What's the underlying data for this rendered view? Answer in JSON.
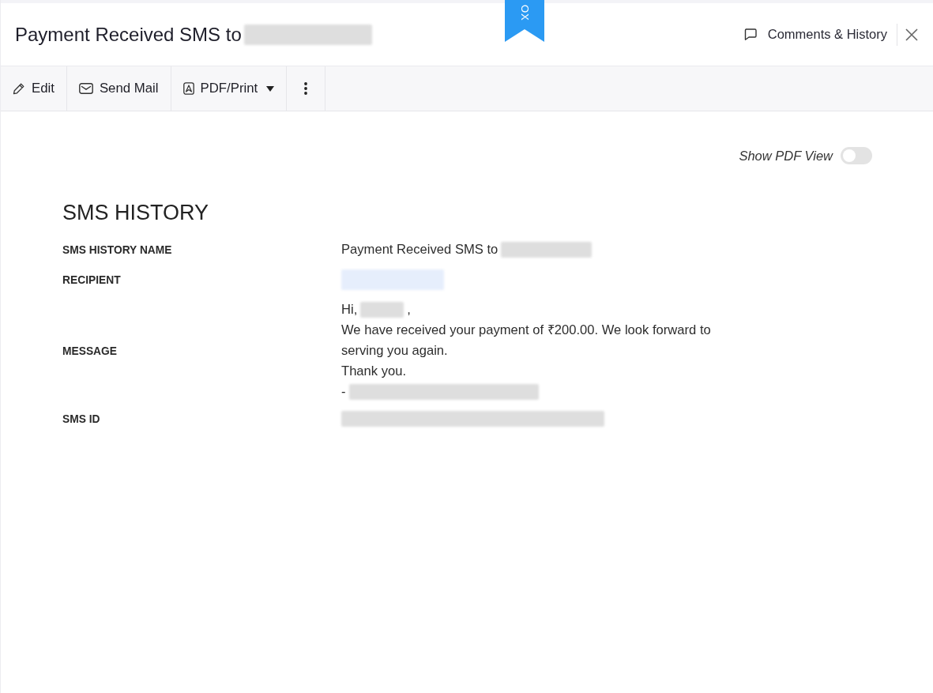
{
  "header": {
    "title": "Payment Received SMS to",
    "title_redacted": true,
    "ribbon": "OX",
    "comments_link": "Comments & History"
  },
  "toolbar": [
    {
      "kind": "edit",
      "label": "Edit"
    },
    {
      "kind": "mail",
      "label": "Send Mail"
    },
    {
      "kind": "pdf",
      "label": "PDF/Print",
      "dropdown": true
    },
    {
      "kind": "more"
    }
  ],
  "pdf_view_toggle": {
    "label": "Show PDF View",
    "on": false
  },
  "section_title": "SMS HISTORY",
  "fields": [
    {
      "kind": "text",
      "label": "SMS HISTORY NAME",
      "value": "Payment Received SMS to",
      "redacted": true
    },
    {
      "kind": "link",
      "label": "RECIPIENT",
      "redacted": true
    },
    {
      "kind": "message",
      "label": "MESSAGE",
      "lines": [
        {
          "kind": "greeting",
          "text": "Hi,",
          "redacted": true,
          "suffix": ","
        },
        {
          "kind": "body",
          "text": "We have received your payment of ₹200.00. We look forward to serving you again."
        },
        {
          "kind": "body",
          "text": "Thank you."
        },
        {
          "kind": "signature",
          "text": "-",
          "redacted": true
        }
      ]
    },
    {
      "kind": "id",
      "label": "SMS ID",
      "redacted": true
    }
  ]
}
